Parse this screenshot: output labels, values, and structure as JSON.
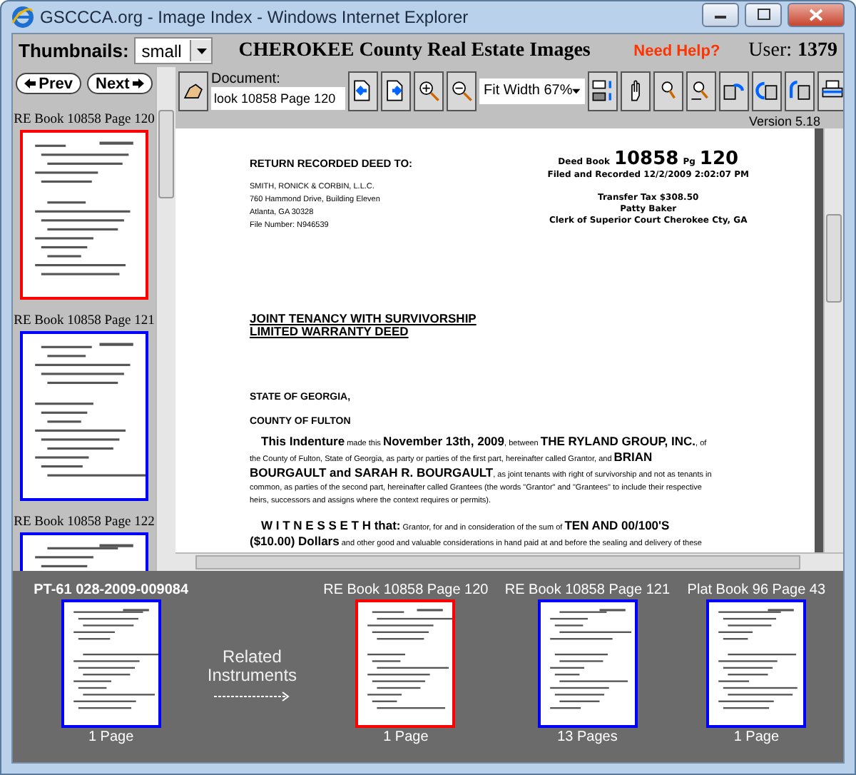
{
  "window": {
    "title": "GSCCCA.org - Image Index - Windows Internet Explorer"
  },
  "header": {
    "thumbnails_label": "Thumbnails:",
    "thumbnails_value": "small",
    "county_title": "CHEROKEE County Real Estate Images",
    "help_link": "Need Help?",
    "user_label": "User:",
    "user_value": "1379"
  },
  "sidebar": {
    "buttons": [
      {
        "label": "Prev",
        "kind": "prev"
      },
      {
        "label": "Next",
        "kind": "next"
      }
    ],
    "thumbnails": [
      {
        "label": "RE Book 10858 Page 120",
        "selected": true
      },
      {
        "label": "RE Book 10858 Page 121",
        "selected": false
      },
      {
        "label": "RE Book 10858 Page 122",
        "selected": false
      }
    ]
  },
  "toolbar": {
    "document_label": "Document:",
    "document_value": "look 10858 Page 120",
    "zoom_value": "Fit Width 67%",
    "version": "Version 5.18"
  },
  "document": {
    "return_heading": "RETURN RECORDED DEED TO:",
    "return_lines": [
      "SMITH, RONICK & CORBIN, L.L.C.",
      "760 Hammond Drive, Building Eleven",
      "Atlanta, GA  30328",
      "File Number: N946539"
    ],
    "deed_book_label": "Deed Book",
    "deed_book": "10858",
    "pg_label": "Pg",
    "deed_page": "120",
    "filed": "Filed and Recorded 12/2/2009 2:02:07 PM",
    "clerk_lines": [
      "Transfer Tax $308.50",
      "Patty Baker",
      "Clerk of Superior Court Cherokee Cty, GA"
    ],
    "title_lines": [
      "JOINT TENANCY WITH SURVIVORSHIP",
      "LIMITED WARRANTY DEED"
    ],
    "state": "STATE OF GEORGIA,",
    "county": "COUNTY OF FULTON",
    "paragraphs": [
      "**This Indenture** made this **November 13th, 2009**, between **THE RYLAND GROUP, INC.**, of the County of Fulton, State of Georgia, as party or parties of the first part, hereinafter called Grantor, and **BRIAN BOURGAULT and SARAH R. BOURGAULT**, as joint tenants with right of survivorship and not as tenants in common, as parties of the second part, hereinafter called Grantees (the words \"Grantor\" and \"Grantees\" to include their respective heirs, successors and assigns where the context requires or permits).",
      "**W I T N E S S E T H that:** Grantor, for and in consideration of the sum of **TEN AND 00/100'S ($10.00) Dollars** and other good and valuable considerations in hand paid at and before the sealing and delivery of these"
    ]
  },
  "related": {
    "label_lines": [
      "Related",
      "Instruments"
    ],
    "items": [
      {
        "kind": "current",
        "title": "PT-61 028-2009-009084",
        "pages": "1 Page",
        "selected": false
      },
      {
        "kind": "related",
        "title": "RE Book 10858 Page 120",
        "pages": "1 Page",
        "selected": true
      },
      {
        "kind": "related",
        "title": "RE Book 10858 Page 121",
        "pages": "13 Pages",
        "selected": false
      },
      {
        "kind": "related",
        "title": "Plat Book 96 Page 43",
        "pages": "1 Page",
        "selected": false
      }
    ]
  }
}
